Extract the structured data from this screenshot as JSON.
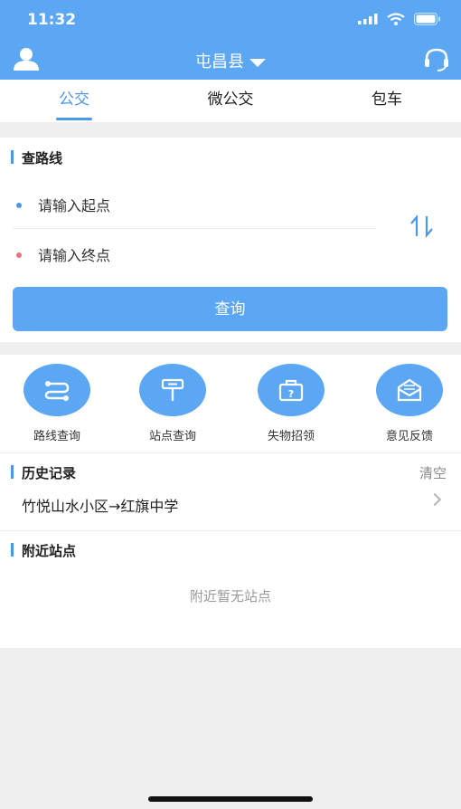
{
  "status_bar": {
    "time": "11:32"
  },
  "header": {
    "city": "屯昌县"
  },
  "tabs": [
    {
      "label": "公交"
    },
    {
      "label": "微公交"
    },
    {
      "label": "包车"
    }
  ],
  "route_search": {
    "section_title": "查路线",
    "start_placeholder": "请输入起点",
    "end_placeholder": "请输入终点",
    "query_label": "查询"
  },
  "functions": [
    {
      "label": "路线查询",
      "icon": "route-icon"
    },
    {
      "label": "站点查询",
      "icon": "stop-sign-icon"
    },
    {
      "label": "失物招领",
      "icon": "lost-found-icon"
    },
    {
      "label": "意见反馈",
      "icon": "feedback-mail-icon"
    }
  ],
  "history": {
    "title": "历史记录",
    "clear_label": "清空",
    "items": [
      {
        "text": "竹悦山水小区→红旗中学"
      }
    ]
  },
  "nearby": {
    "title": "附近站点",
    "empty_text": "附近暂无站点"
  },
  "colors": {
    "primary": "#5ba7f3",
    "accent": "#4a98ea",
    "start_dot": "#4a98ea",
    "end_dot": "#e8747c"
  }
}
